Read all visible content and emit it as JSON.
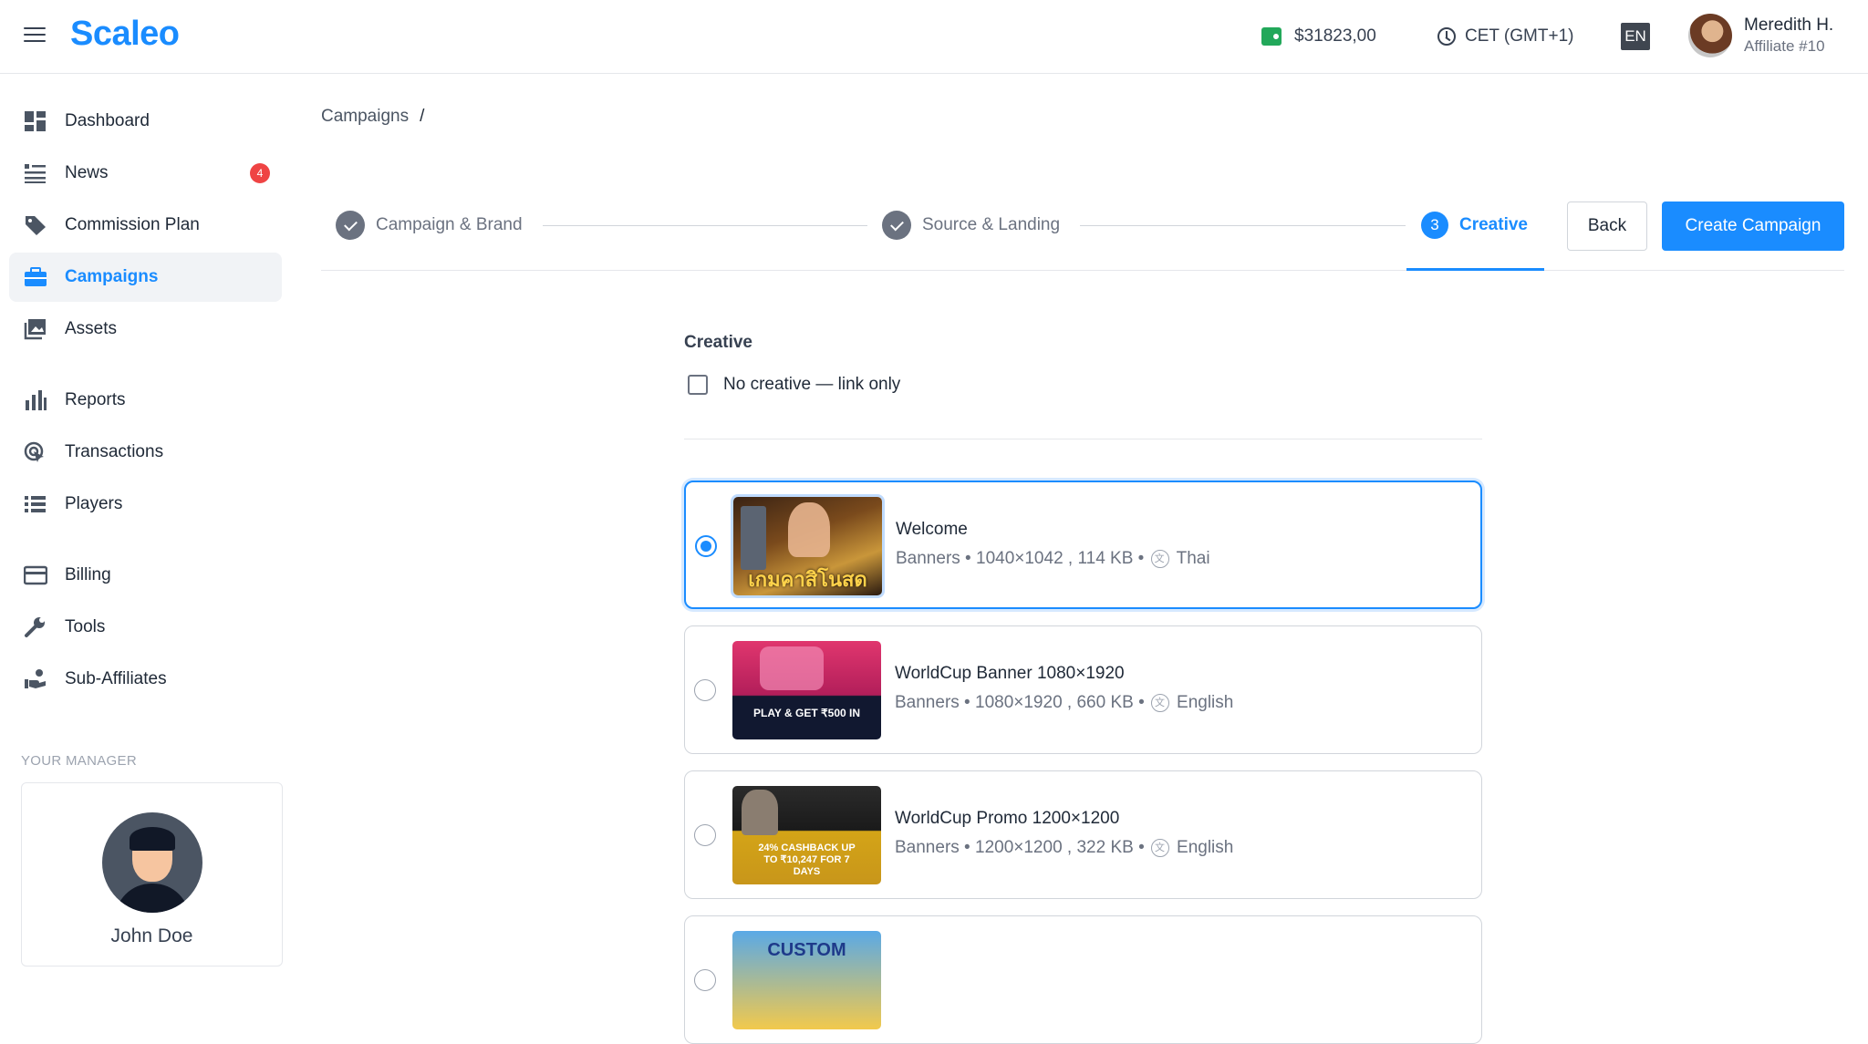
{
  "header": {
    "logo": "Scaleo",
    "balance": "$31823,00",
    "timezone": "CET (GMT+1)",
    "language": "EN",
    "user_name": "Meredith H.",
    "user_role": "Affiliate #10"
  },
  "sidebar": {
    "items": [
      {
        "label": "Dashboard",
        "icon": "dashboard-icon"
      },
      {
        "label": "News",
        "icon": "news-icon",
        "badge": "4"
      },
      {
        "label": "Commission Plan",
        "icon": "tag-icon"
      },
      {
        "label": "Campaigns",
        "icon": "briefcase-icon",
        "active": true
      },
      {
        "label": "Assets",
        "icon": "images-icon"
      },
      {
        "label": "Reports",
        "icon": "bar-chart-icon"
      },
      {
        "label": "Transactions",
        "icon": "touch-icon"
      },
      {
        "label": "Players",
        "icon": "list-icon"
      },
      {
        "label": "Billing",
        "icon": "credit-card-icon"
      },
      {
        "label": "Tools",
        "icon": "wrench-icon"
      },
      {
        "label": "Sub-Affiliates",
        "icon": "hand-coins-icon"
      }
    ],
    "manager_title": "YOUR MANAGER",
    "manager_name": "John Doe"
  },
  "main": {
    "breadcrumb": "Campaigns",
    "breadcrumb_sep": "/",
    "steps": [
      {
        "label": "Campaign & Brand",
        "state": "done"
      },
      {
        "label": "Source & Landing",
        "state": "done"
      },
      {
        "number": "3",
        "label": "Creative",
        "state": "active"
      }
    ],
    "back_label": "Back",
    "create_label": "Create Campaign",
    "section_title": "Creative",
    "no_creative_label": "No creative — link only",
    "creatives": [
      {
        "title": "Welcome",
        "type": "Banners",
        "size": "1040×1042",
        "weight": "114 KB",
        "language": "Thai",
        "selected": true,
        "thumb_text": "เกมคาสิโนสด"
      },
      {
        "title": "WorldCup Banner 1080×1920",
        "type": "Banners",
        "size": "1080×1920",
        "weight": "660 KB",
        "language": "English",
        "selected": false,
        "thumb_text": "PLAY & GET ₹500 IN"
      },
      {
        "title": "WorldCup Promo 1200×1200",
        "type": "Banners",
        "size": "1200×1200",
        "weight": "322 KB",
        "language": "English",
        "selected": false,
        "thumb_text": "24% CASHBACK UP TO ₹10,247 FOR 7 DAYS"
      },
      {
        "title": "",
        "type": "",
        "size": "",
        "weight": "",
        "language": "",
        "selected": false,
        "thumb_text": "CUSTOM"
      }
    ],
    "colors": {
      "accent": "#1a8cff",
      "badge": "#ef4444",
      "wallet": "#22a85a"
    }
  }
}
